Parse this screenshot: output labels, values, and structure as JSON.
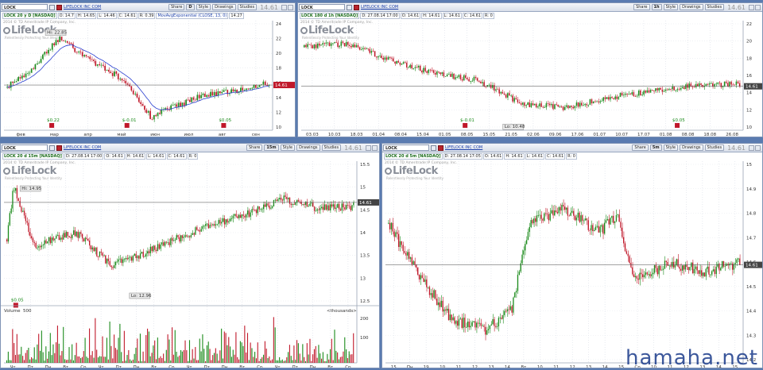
{
  "symbol": "LOCK",
  "company": "LIFELOCK INC COM",
  "copyright": "2014 © TD Ameritrade IP Company, Inc.",
  "logo_text": "LifeLock",
  "logo_tagline": "Relentlessly Protecting Your Identity",
  "toolbar": {
    "share": "Share",
    "style": "Style",
    "drawings": "Drawings",
    "studies": "Studies"
  },
  "last_price": "14.61",
  "watermark": "hamaha.net",
  "panels": [
    {
      "timeframe": "D",
      "info": [
        "LOCK 20 y D [NASDAQ]",
        "O: 14.7",
        "H: 14.65",
        "L: 14.46",
        "C: 14.61",
        "R: 0.39",
        "MovAvgExponential (CLOSE, 13, 0)",
        "14.27"
      ],
      "price_ticks": [
        "24",
        "22",
        "20",
        "18",
        "16",
        "14",
        "12",
        "10"
      ],
      "time_ticks": [
        "фев",
        "мар",
        "апр",
        "май",
        "июн",
        "июл",
        "авг",
        "сен"
      ],
      "annotations": [
        "Hi: 22.85",
        "$0.22",
        "$-0.01",
        "$0.05"
      ],
      "price_tag": "14.61"
    },
    {
      "timeframe": "1h",
      "info": [
        "LOCK 180 d 1h [NASDAQ]",
        "D: 27.08.14 17:00",
        "O: 14.61",
        "H: 14.61",
        "L: 14.61",
        "C: 14.61",
        "R: 0"
      ],
      "price_ticks": [
        "22",
        "20",
        "18",
        "16",
        "14",
        "12",
        "10"
      ],
      "time_ticks": [
        "03.03",
        "10.03",
        "18.03",
        "01.04",
        "08.04",
        "15.04",
        "01.05",
        "08.05",
        "15.05",
        "21.05",
        "02.06",
        "09.06",
        "17.06",
        "01.07",
        "10.07",
        "17.07",
        "01.08",
        "08.08",
        "18.08",
        "26.08"
      ],
      "annotations": [
        "$-0.01",
        "Lo: 10.48",
        "$0.05"
      ],
      "price_tag": "14.61"
    },
    {
      "timeframe": "15m",
      "info": [
        "LOCK 20 d 15m [NASDAQ]",
        "D: 27.08.14 17:00",
        "O: 14.61",
        "H: 14.61",
        "L: 14.61",
        "C: 14.61",
        "R: 0"
      ],
      "price_ticks": [
        "15.5",
        "15",
        "14.5",
        "14",
        "13.5",
        "13",
        "12.5"
      ],
      "time_ticks": [
        "Чт",
        "Пт",
        "Пн",
        "Вт",
        "Ср",
        "Чт",
        "Пт",
        "Пн",
        "Вт",
        "Ср",
        "Чт",
        "Пт",
        "Пн",
        "Вт",
        "Ср",
        "Чт",
        "Пт",
        "Пн",
        "Вт",
        "Ср"
      ],
      "annotations": [
        "Hi: 14.95",
        "Lo: 12.96",
        "$0.05"
      ],
      "price_tag": "14.61",
      "volume": {
        "label": "Volume",
        "value": "500",
        "unit": "<thousands>",
        "ticks": [
          "200",
          "100"
        ]
      }
    },
    {
      "timeframe": "5m",
      "info": [
        "LOCK 20 d 5m [NASDAQ]",
        "D: 27.08.14 17:05",
        "O: 14.61",
        "H: 14.61",
        "L: 14.61",
        "C: 14.61",
        "R: 0"
      ],
      "price_ticks": [
        "15",
        "14.9",
        "14.8",
        "14.7",
        "14.6",
        "14.5",
        "14.4",
        "14.3",
        "14.2"
      ],
      "time_ticks": [
        "15",
        "Пн",
        "19",
        "10",
        "11",
        "12",
        "13",
        "14",
        "Вт",
        "10",
        "11",
        "12",
        "13",
        "14",
        "15",
        "Ср",
        "10",
        "11",
        "12",
        "13",
        "14",
        "15"
      ],
      "annotations": [],
      "price_tag": "14.61"
    }
  ]
}
